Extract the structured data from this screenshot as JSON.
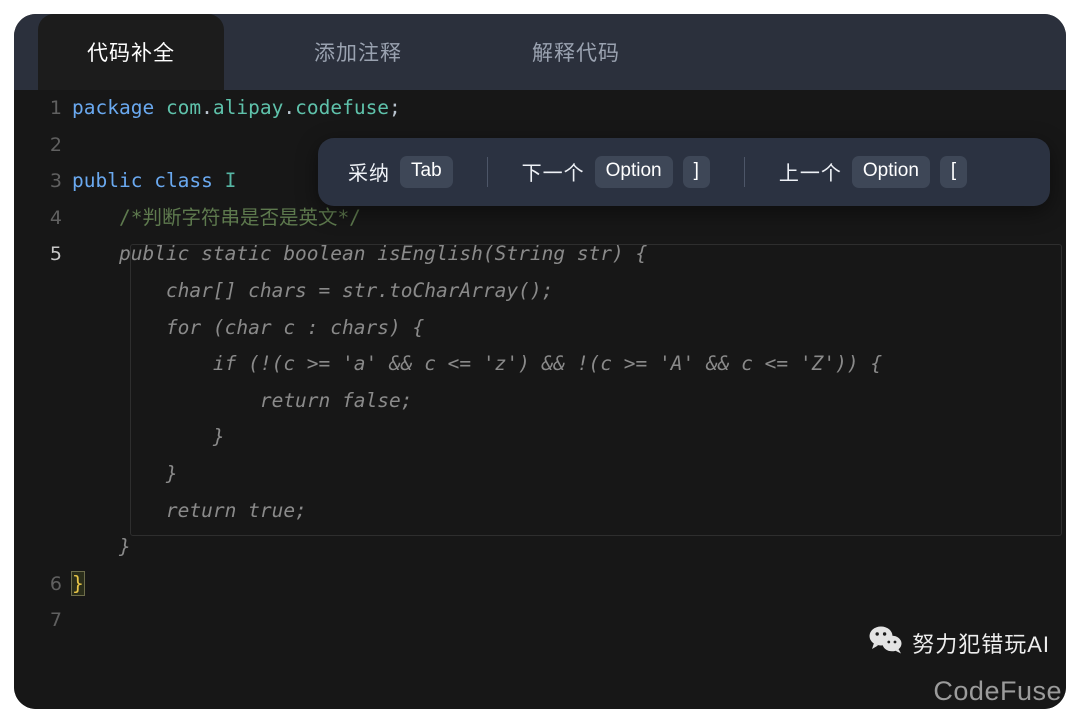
{
  "tabs": [
    {
      "label": "代码补全",
      "active": true
    },
    {
      "label": "添加注释",
      "active": false
    },
    {
      "label": "解释代码",
      "active": false
    }
  ],
  "popup": {
    "hints": [
      {
        "label": "采纳",
        "key": "Tab"
      },
      {
        "label": "下一个",
        "key": "Option",
        "key2": "]"
      },
      {
        "label": "上一个",
        "key": "Option",
        "key2": "["
      }
    ]
  },
  "editor": {
    "language": "java",
    "lines": [
      {
        "number": "1",
        "current": false,
        "tokens": [
          {
            "t": "package",
            "c": "kw"
          },
          {
            "t": " ",
            "c": "pun"
          },
          {
            "t": "com",
            "c": "pkg"
          },
          {
            "t": ".",
            "c": "pun"
          },
          {
            "t": "alipay",
            "c": "pkg"
          },
          {
            "t": ".",
            "c": "pun"
          },
          {
            "t": "codefuse",
            "c": "pkg"
          },
          {
            "t": ";",
            "c": "pun"
          }
        ]
      },
      {
        "number": "2",
        "current": false,
        "tokens": []
      },
      {
        "number": "3",
        "current": false,
        "tokens": [
          {
            "t": "public",
            "c": "kw"
          },
          {
            "t": " ",
            "c": "pun"
          },
          {
            "t": "class",
            "c": "kw"
          },
          {
            "t": " ",
            "c": "pun"
          },
          {
            "t": "I",
            "c": "typ"
          }
        ]
      },
      {
        "number": "4",
        "current": false,
        "tokens": [
          {
            "t": "    /*判断字符串是否是英文*/",
            "c": "cmt"
          }
        ]
      },
      {
        "number": "5",
        "current": true,
        "tokens": [
          {
            "t": "    public static boolean isEnglish(String str) {",
            "c": "ghost"
          }
        ]
      },
      {
        "number": "",
        "current": false,
        "tokens": [
          {
            "t": "        char[] chars = str.toCharArray();",
            "c": "ghost"
          }
        ]
      },
      {
        "number": "",
        "current": false,
        "tokens": [
          {
            "t": "        for (char c : chars) {",
            "c": "ghost"
          }
        ]
      },
      {
        "number": "",
        "current": false,
        "tokens": [
          {
            "t": "            if (!(c >= 'a' && c <= 'z') && !(c >= 'A' && c <= 'Z')) {",
            "c": "ghost"
          }
        ]
      },
      {
        "number": "",
        "current": false,
        "tokens": [
          {
            "t": "                return false;",
            "c": "ghost"
          }
        ]
      },
      {
        "number": "",
        "current": false,
        "tokens": [
          {
            "t": "            }",
            "c": "ghost"
          }
        ]
      },
      {
        "number": "",
        "current": false,
        "tokens": [
          {
            "t": "        }",
            "c": "ghost"
          }
        ]
      },
      {
        "number": "",
        "current": false,
        "tokens": [
          {
            "t": "        return true;",
            "c": "ghost"
          }
        ]
      },
      {
        "number": "",
        "current": false,
        "tokens": [
          {
            "t": "    }",
            "c": "ghost"
          }
        ]
      },
      {
        "number": "6",
        "current": false,
        "tokens": [
          {
            "t": "}",
            "c": "brace-hl"
          }
        ]
      },
      {
        "number": "7",
        "current": false,
        "tokens": []
      }
    ]
  },
  "watermark": {
    "account": "努力犯错玩AI",
    "brand": "CodeFuse"
  },
  "colors": {
    "page_background": "#ffffff",
    "editor_background": "#171717",
    "tabbar_background": "#2b303c",
    "active_tab_background": "#1c1c1c",
    "popup_background": "#2b3241",
    "keycap_background": "#3e4757",
    "keyword": "#6aa9f0",
    "package": "#5fc2ab",
    "comment": "#5e7a4e",
    "ghost_text": "#8a8a8a",
    "brace_highlight": "#e8c547"
  }
}
